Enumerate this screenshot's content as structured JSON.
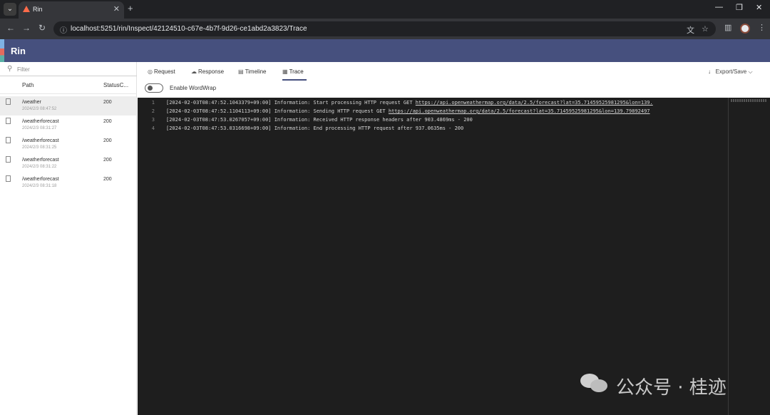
{
  "browser": {
    "tab_menu_icon": "chevron-down-icon",
    "tab_title": "Rin",
    "tab_close": "✕",
    "new_tab": "+",
    "window_controls": [
      "—",
      "❐",
      "✕"
    ],
    "url": "localhost:5251/rin/Inspect/42124510-c67e-4b7f-9d26-ce1abd2a3823/Trace",
    "nav": {
      "back": "←",
      "forward": "→",
      "reload": "↻"
    },
    "omnibox_icon": "info-icon",
    "translate_icon": "文",
    "star_icon": "☆",
    "sidepanel_icon": "▥",
    "menu_icon": "⋮"
  },
  "app": {
    "title": "Rin",
    "accent_colors": [
      "#7fb2e5",
      "#e36b5e",
      "#5ab0a6"
    ],
    "header_color": "#46507e"
  },
  "sidebar": {
    "filter_placeholder": "Filter",
    "columns": {
      "path": "Path",
      "status": "StatusC..."
    },
    "rows": [
      {
        "path": "/weather",
        "time": "2024/2/3 08:47:52",
        "status": "200",
        "selected": true
      },
      {
        "path": "/weatherforecast",
        "time": "2024/2/3 08:31:27",
        "status": "200",
        "selected": false
      },
      {
        "path": "/weatherforecast",
        "time": "2024/2/3 08:31:25",
        "status": "200",
        "selected": false
      },
      {
        "path": "/weatherforecast",
        "time": "2024/2/3 08:31:22",
        "status": "200",
        "selected": false
      },
      {
        "path": "/weatherforecast",
        "time": "2024/2/3 08:31:18",
        "status": "200",
        "selected": false
      }
    ]
  },
  "main": {
    "tabs": [
      {
        "label": "Request",
        "icon": "eye-icon",
        "glyph": "◎"
      },
      {
        "label": "Response",
        "icon": "cloud-icon",
        "glyph": "☁"
      },
      {
        "label": "Timeline",
        "icon": "timeline-icon",
        "glyph": "▤"
      },
      {
        "label": "Trace",
        "icon": "trace-icon",
        "glyph": "▦",
        "active": true
      }
    ],
    "export_label": "Export/Save",
    "export_icon": "↓",
    "export_chevron": "⌵",
    "wordwrap_label": "Enable WordWrap",
    "wordwrap_enabled": false,
    "trace_lines": [
      {
        "n": "1",
        "pre": "[2024-02-03T08:47:52.1043379+09:00] Information: Start processing HTTP request GET ",
        "link": "https://api.openweathermap.org/data/2.5/forecast?lat=35.71459525981295&lon=139."
      },
      {
        "n": "2",
        "pre": "[2024-02-03T08:47:52.1104113+09:00] Information: Sending HTTP request GET ",
        "link": "https://api.openweathermap.org/data/2.5/forecast?lat=35.71459525981295&lon=139.79892497"
      },
      {
        "n": "3",
        "pre": "[2024-02-03T08:47:53.0267057+09:00] Information: Received HTTP response headers after 903.4869ms - 200",
        "link": ""
      },
      {
        "n": "4",
        "pre": "[2024-02-03T08:47:53.0316698+09:00] Information: End processing HTTP request after 937.0635ms - 200",
        "link": ""
      }
    ]
  },
  "watermark": {
    "text": "公众号 · 桂迹"
  }
}
